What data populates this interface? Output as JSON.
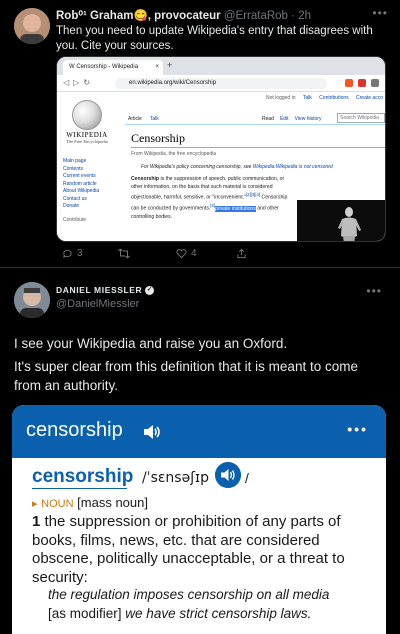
{
  "tweet1": {
    "name": "Rob⁰¹ Graham",
    "emoji": "😋",
    "name_suffix": ", provocateur",
    "handle": "@ErrataRob",
    "time": "2h",
    "text": "Then you need to update Wikipedia's entry that disagrees with you. Cite your sources.",
    "screenshot": {
      "tab_title": "Censorship - Wikipedia",
      "new_tab": "+",
      "url": "en.wikipedia.org/wiki/Censorship",
      "user_links": [
        "Not logged in",
        "Talk",
        "Contributions",
        "Create acco"
      ],
      "logo_title": "WIKIPEDIA",
      "logo_subtitle": "The Free Encyclopedia",
      "tabs_left": [
        "Article",
        "Talk"
      ],
      "tabs_right": [
        "Read",
        "Edit",
        "View history"
      ],
      "search_placeholder": "Search Wikipedia",
      "sidebar": [
        "Main page",
        "Contents",
        "Current events",
        "Random article",
        "About Wikipedia",
        "Contact us",
        "Donate"
      ],
      "sidebar_section": "Contribute",
      "title": "Censorship",
      "from": "From Wikipedia, the free encyclopedia",
      "hatnote_prefix": "For Wikipedia's policy concerning censorship, see",
      "hatnote_link": "Wikipedia:Wikipedia is not censored",
      "body_bold": "Censorship",
      "body_1": " is the suppression of speech, public communication, or other information, on the basis that such material is considered objectionable, harmful, sensitive, or \"inconvenient.\"",
      "body_ref": "[2][3][4]",
      "body_2": " Censorship can be conducted by governments,",
      "body_ref2": "[5]",
      "body_highlight": "private institutions",
      "body_3": " and other controlling bodies."
    },
    "actions": {
      "replies": "3",
      "retweets": "",
      "likes": "4"
    }
  },
  "tweet2": {
    "name": "DANIEL MIESSLER",
    "handle": "@DanielMiessler",
    "p1": "I see your Wikipedia and raise you an Oxford.",
    "p2": "It's super clear from this definition that it is meant to come from an authority.",
    "oxford": {
      "bar_word": "censorship",
      "dots": "•••",
      "headword": "censorship",
      "pronunciation": "/ˈsɛnsəʃɪp",
      "slash": "/",
      "pos_marker": "▸",
      "pos": "NOUN",
      "grammar": "[mass noun]",
      "sense_num": "1",
      "definition": "the suppression or prohibition of any parts of books, films, news, etc. that are considered obscene, politically unacceptable, or a threat to security:",
      "example1": "the regulation imposes censorship on all media",
      "example2_label": "[as modifier]",
      "example2": "we have strict censorship laws."
    }
  },
  "colors": {
    "oxford_blue": "#0b60ad",
    "twitter_bg": "#000000",
    "text": "#e7e9ea",
    "muted": "#71767b",
    "noun_orange": "#c8791a",
    "wiki_link": "#0645ad"
  }
}
